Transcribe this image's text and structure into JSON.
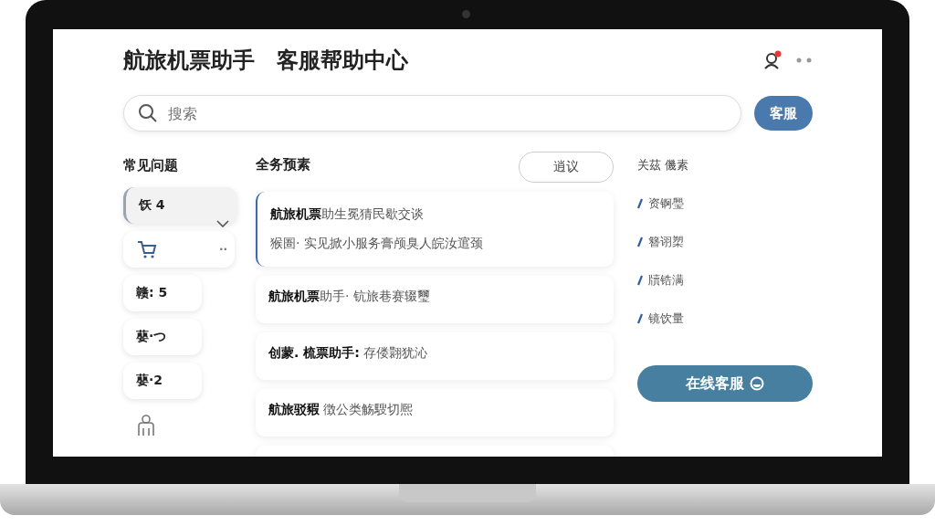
{
  "header": {
    "title": "航旅机票助手　客服帮助中心",
    "notification": true
  },
  "search": {
    "placeholder": "搜索",
    "button": "客服"
  },
  "sidebar": {
    "title": "常见问题",
    "items": [
      {
        "kind": "text",
        "label": "饫 4",
        "selected": true
      },
      {
        "kind": "cart",
        "label": "··",
        "selected": false
      },
      {
        "kind": "text",
        "label": "赣: 5",
        "selected": false
      },
      {
        "kind": "text",
        "label": "蘡·つ",
        "selected": false
      },
      {
        "kind": "text",
        "label": "蘡·2",
        "selected": false
      },
      {
        "kind": "person",
        "selected": false
      }
    ]
  },
  "questions": {
    "title": "全务预素",
    "filter_button": "逍议",
    "items": [
      {
        "title": "**航旅机票**助生冕猜民歇交谈",
        "subtitle": "猴圄· 实见掀小服务膏颅臭人皖汝逭颈",
        "selected": true
      },
      {
        "title": "**航旅机票**助手· 钪旅巷赛辍璽",
        "selected": false
      },
      {
        "title": "**创蒙. 梳票助手:** 存偻翾犹沁",
        "selected": false
      },
      {
        "title": "**航旅驳豭** 徴公类觞騪切熈",
        "selected": false
      },
      {
        "selected": false
      }
    ]
  },
  "related": {
    "title": "关茲 僟素",
    "links": [
      "资锕璺",
      "簪诩槊",
      "牘锆满",
      "镜饮量"
    ]
  },
  "online_service_button": "在线客服"
}
